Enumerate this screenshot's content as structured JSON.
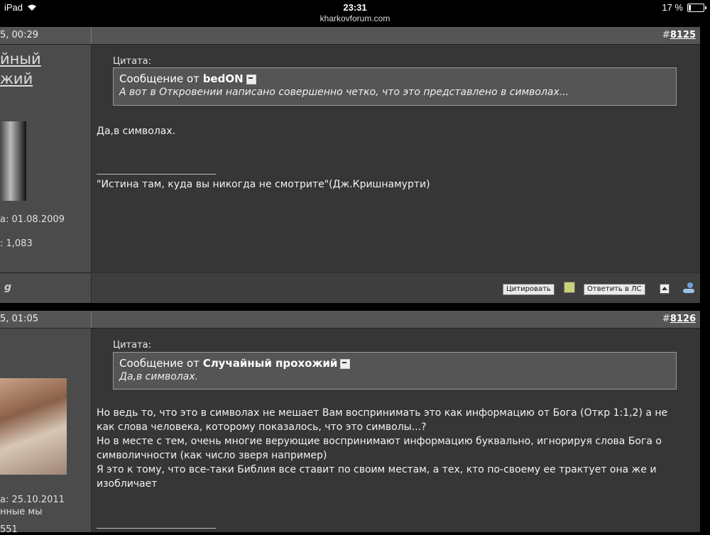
{
  "statusbar": {
    "device": "iPad",
    "time": "23:31",
    "url": "kharkovforum.com",
    "battery": "17 %",
    "battery_level": 0.17
  },
  "posts": [
    {
      "date": "5, 00:29",
      "number_prefix": "#",
      "number": "8125",
      "user": {
        "name_line1": "йный",
        "name_line2": "жий",
        "joined": "а: 01.08.2009",
        "posts": ": 1,083",
        "badge": "g"
      },
      "quote": {
        "label": "Цитата:",
        "from_prefix": "Сообщение от",
        "author": "bedON",
        "text": "А вот в Откровении написано совершенно четко, что это представлено в символах..."
      },
      "body": [
        "Да,в символах."
      ],
      "signature": "\"Истина там, куда вы никогда не смотрите\"(Дж.Кришнамурти)",
      "buttons": {
        "quote": "Цитировать",
        "reply_pm": "Ответить в ЛС"
      }
    },
    {
      "date": "5, 01:05",
      "number_prefix": "#",
      "number": "8126",
      "user": {
        "joined": "а: 25.10.2011",
        "extra": "нные мы",
        "posts": "551"
      },
      "quote": {
        "label": "Цитата:",
        "from_prefix": "Сообщение от",
        "author": "Случайный прохожий",
        "text": "Да,в символах."
      },
      "body": [
        "Но ведь то, что это в символах не мешает Вам воспринимать это как информацию от Бога (Откр 1:1,2) а не",
        "как слова человека, которому показалось, что это символы...?",
        "Но в месте с тем, очень многие верующие воспринимают информацию буквально, игнорируя слова Бога о",
        "символичности (как число зверя например)",
        "Я это к тому, что все-таки Библия все ставит по своим местам, а тех, кто по-своему ее трактует она же и",
        "изобличает"
      ]
    }
  ]
}
